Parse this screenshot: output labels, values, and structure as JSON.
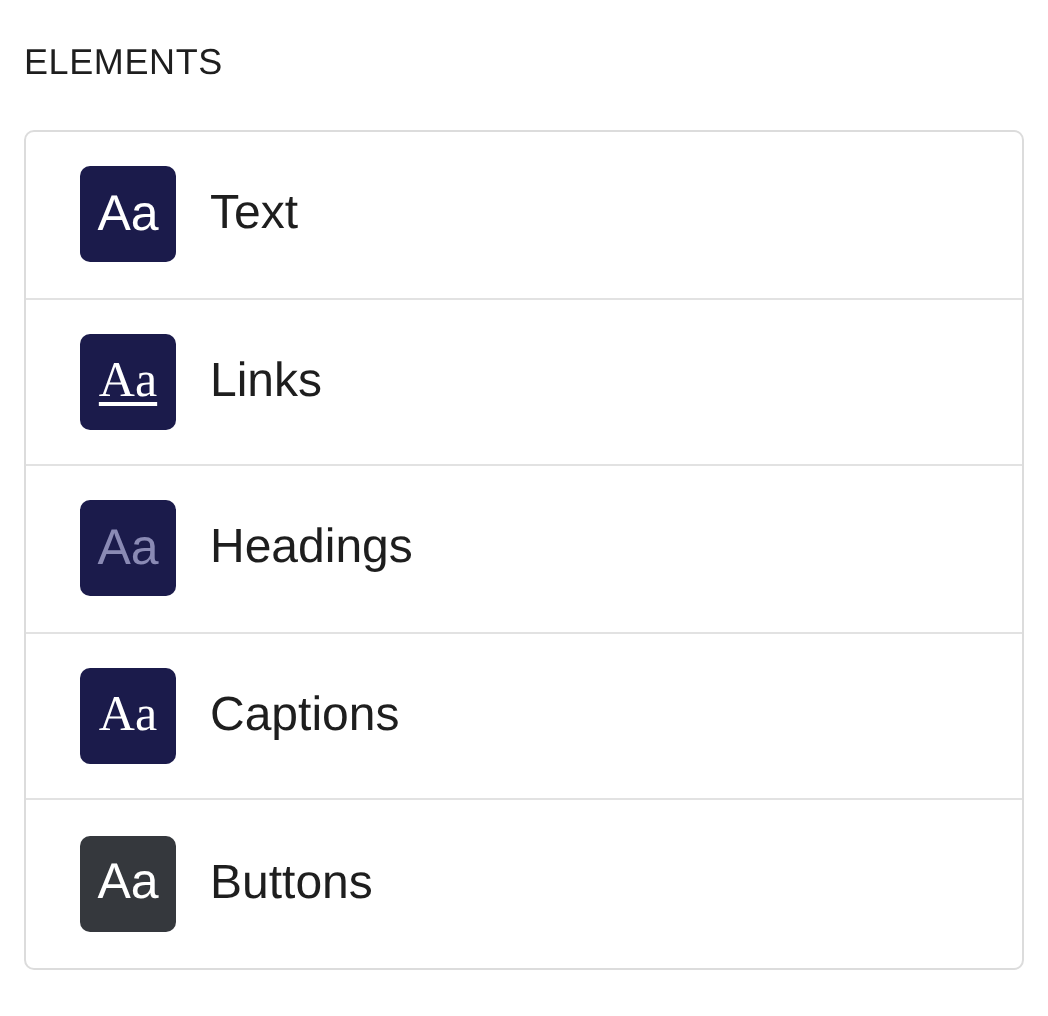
{
  "section_title": "ELEMENTS",
  "items": [
    {
      "label": "Text",
      "icon_text": "Aa",
      "kind": "sans"
    },
    {
      "label": "Links",
      "icon_text": "Aa",
      "kind": "link"
    },
    {
      "label": "Headings",
      "icon_text": "Aa",
      "kind": "heading"
    },
    {
      "label": "Captions",
      "icon_text": "Aa",
      "kind": "serif"
    },
    {
      "label": "Buttons",
      "icon_text": "Aa",
      "kind": "button"
    }
  ]
}
